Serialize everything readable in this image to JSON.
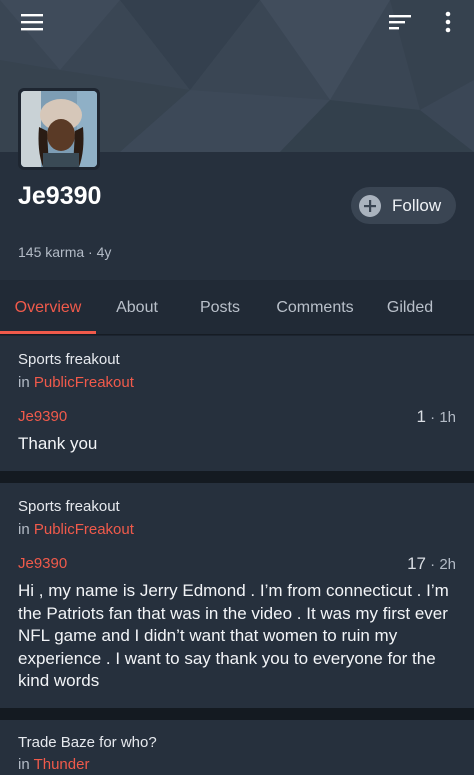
{
  "profile": {
    "username": "Je9390",
    "karma": "145 karma",
    "age": "4y",
    "meta_sep": " · ",
    "follow_label": "Follow"
  },
  "tabs": [
    {
      "label": "Overview",
      "active": true
    },
    {
      "label": "About",
      "active": false
    },
    {
      "label": "Posts",
      "active": false
    },
    {
      "label": "Comments",
      "active": false
    },
    {
      "label": "Gilded",
      "active": false
    }
  ],
  "comments": [
    {
      "post_title": "Sports freakout",
      "in_prefix": "in ",
      "subreddit": "PublicFreakout",
      "author": "Je9390",
      "score": "1",
      "time": " · 1h",
      "body": "Thank you"
    },
    {
      "post_title": "Sports freakout",
      "in_prefix": "in ",
      "subreddit": "PublicFreakout",
      "author": "Je9390",
      "score": "17",
      "time": " · 2h",
      "body": "Hi , my name is Jerry Edmond . I’m from connecticut . I’m the Patriots fan that was in the video . It was my first ever NFL game and I didn’t want that women to ruin my experience . I want to say thank you to everyone for the kind words"
    },
    {
      "post_title": "Trade Baze for who?",
      "in_prefix": "in ",
      "subreddit": "Thunder"
    }
  ],
  "icons": {
    "menu": "hamburger-menu-icon",
    "sort": "sort-icon",
    "overflow": "more-vertical-icon",
    "follow": "plus-circle-icon"
  },
  "colors": {
    "accent": "#f05a4b",
    "background": "#1c2430",
    "card": "#26303d"
  }
}
